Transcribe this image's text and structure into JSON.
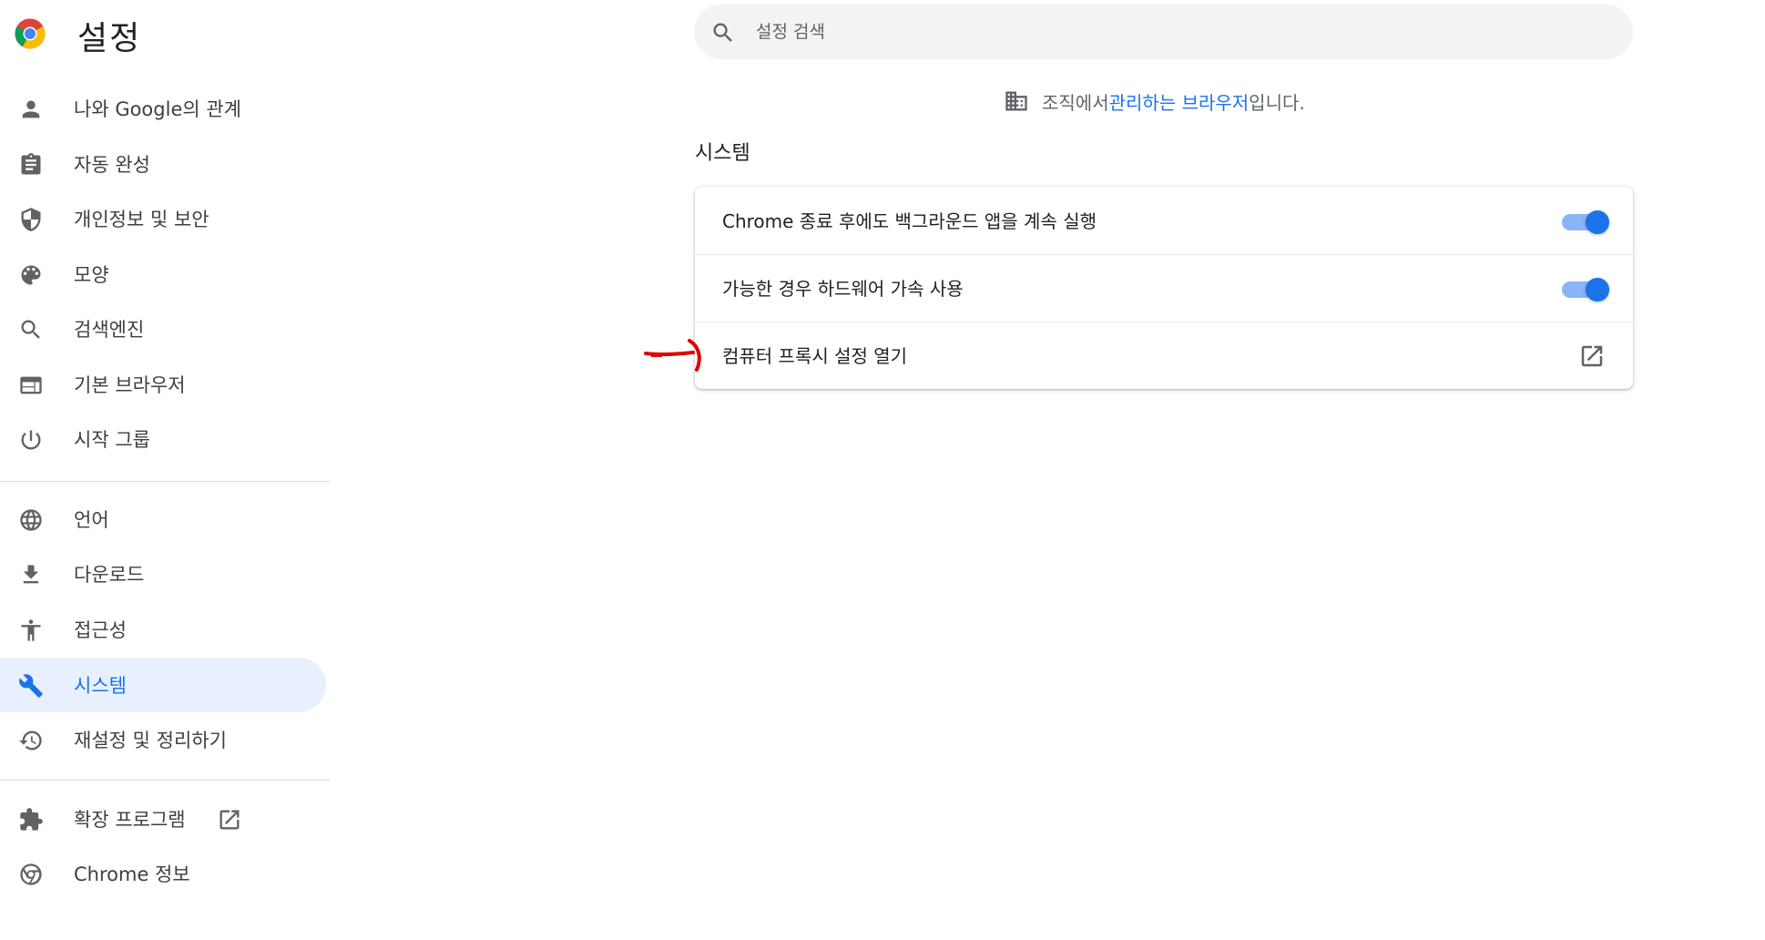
{
  "header": {
    "title": "설정",
    "search_placeholder": "설정 검색"
  },
  "sidebar": {
    "items": [
      {
        "label": "나와 Google의 관계",
        "icon": "person-icon"
      },
      {
        "label": "자동 완성",
        "icon": "clipboard-icon"
      },
      {
        "label": "개인정보 및 보안",
        "icon": "shield-icon"
      },
      {
        "label": "모양",
        "icon": "palette-icon"
      },
      {
        "label": "검색엔진",
        "icon": "search-icon"
      },
      {
        "label": "기본 브라우저",
        "icon": "browser-window-icon"
      },
      {
        "label": "시작 그룹",
        "icon": "power-icon"
      },
      {
        "label": "언어",
        "icon": "globe-icon"
      },
      {
        "label": "다운로드",
        "icon": "download-icon"
      },
      {
        "label": "접근성",
        "icon": "accessibility-icon"
      },
      {
        "label": "시스템",
        "icon": "wrench-icon",
        "active": true
      },
      {
        "label": "재설정 및 정리하기",
        "icon": "history-icon"
      },
      {
        "label": "확장 프로그램",
        "icon": "puzzle-icon"
      },
      {
        "label": "Chrome 정보",
        "icon": "chrome-icon"
      }
    ]
  },
  "managed_notice": {
    "prefix": "조직에서 ",
    "link": "관리하는 브라우저",
    "suffix": "입니다.",
    "icon": "building-icon"
  },
  "section": {
    "title": "시스템",
    "rows": [
      {
        "label": "Chrome 종료 후에도 백그라운드 앱을 계속 실행",
        "toggle_on": true
      },
      {
        "label": "가능한 경우 하드웨어 가속 사용",
        "toggle_on": true
      },
      {
        "label": "컴퓨터 프록시 설정 열기",
        "icon": "open-external-icon"
      }
    ]
  },
  "colors": {
    "accent": "#1a73e8",
    "active_bg": "#e8f0fe",
    "annotation": "#e00000"
  }
}
